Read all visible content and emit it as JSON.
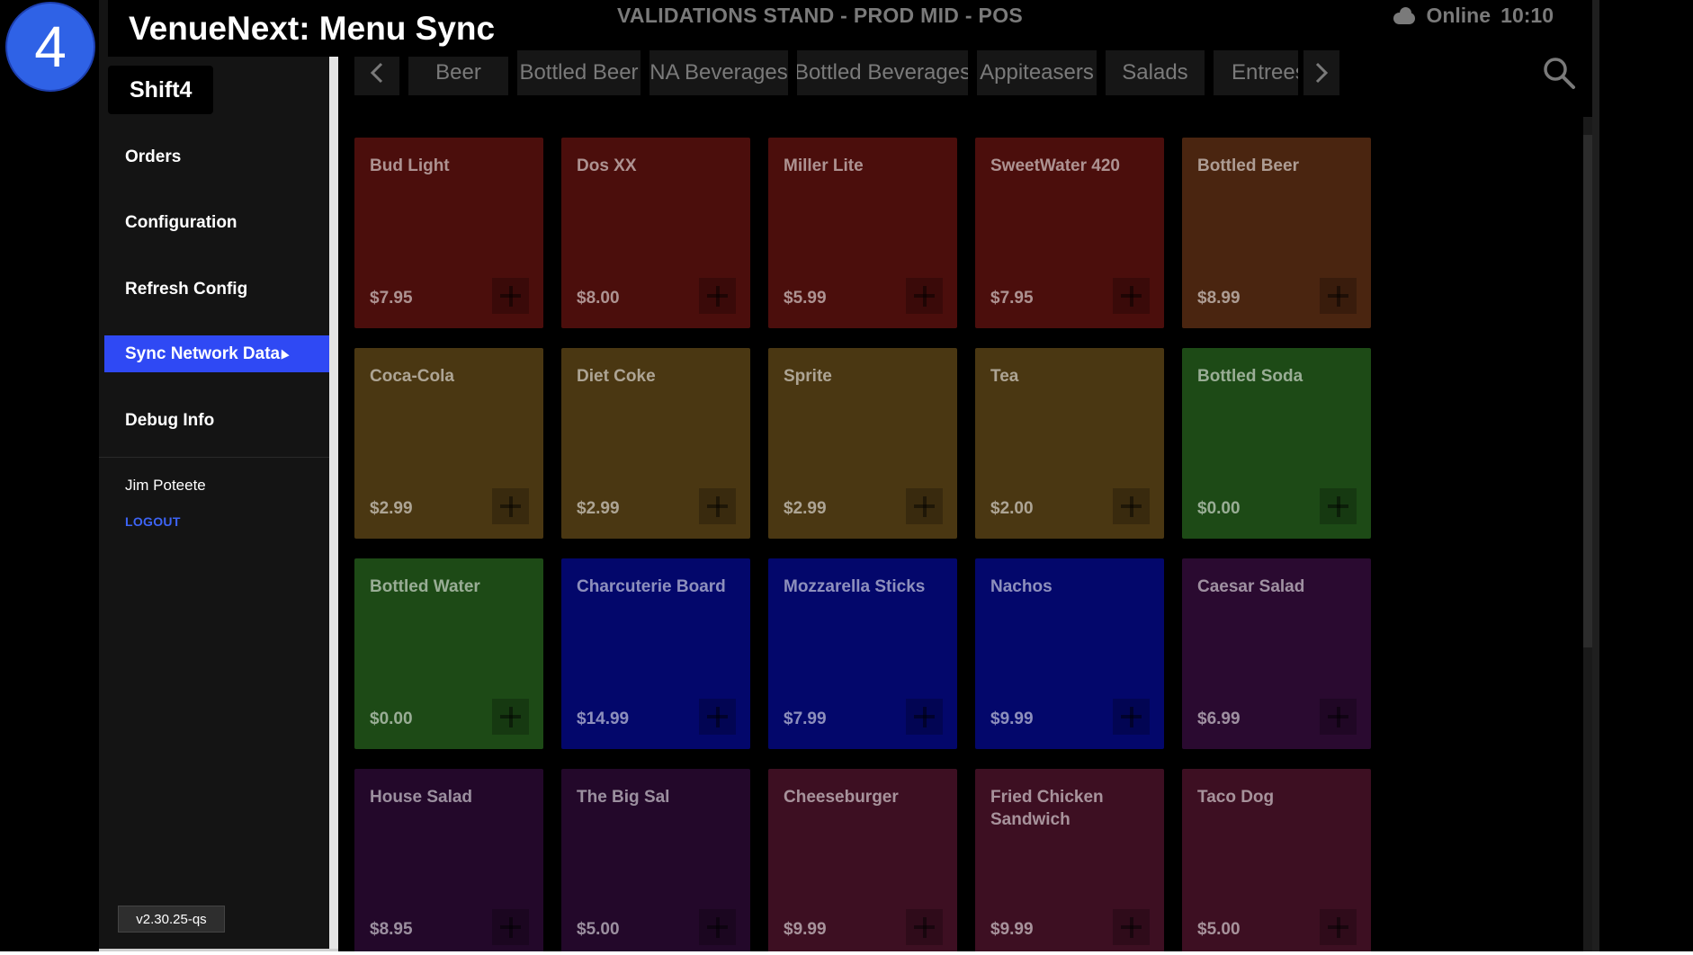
{
  "overlay": {
    "step_number": "4",
    "caption": "VenueNext: Menu Sync",
    "subcaption": "Shift4"
  },
  "sidebar": {
    "items": [
      {
        "label": "Orders",
        "active": false
      },
      {
        "label": "Configuration",
        "active": false
      },
      {
        "label": "Refresh Config",
        "active": false
      },
      {
        "label": "Sync Network Data",
        "active": true
      },
      {
        "label": "Debug Info",
        "active": false
      }
    ],
    "user_name": "Jim Poteete",
    "logout_label": "LOGOUT",
    "version": "v2.30.25-qs"
  },
  "header": {
    "title": "VALIDATIONS STAND - PROD MID - POS",
    "status": "Online",
    "time": "10:10",
    "status_icon": "cloud-check-icon"
  },
  "tabs": [
    "Beer",
    "Bottled Beer",
    "NA Beverages",
    "Bottled Beverages",
    "Appiteasers",
    "Salads",
    "Entrees"
  ],
  "tiles": [
    {
      "name": "Bud Light",
      "price": "$7.95",
      "color": "#4b0e0c"
    },
    {
      "name": "Dos XX",
      "price": "$8.00",
      "color": "#4b0e0c"
    },
    {
      "name": "Miller Lite",
      "price": "$5.99",
      "color": "#4b0e0c"
    },
    {
      "name": "SweetWater 420",
      "price": "$7.95",
      "color": "#4b0e0c"
    },
    {
      "name": "Bottled Beer",
      "price": "$8.99",
      "color": "#4a2510"
    },
    {
      "name": "Coca-Cola",
      "price": "$2.99",
      "color": "#4a3712"
    },
    {
      "name": "Diet Coke",
      "price": "$2.99",
      "color": "#4a3712"
    },
    {
      "name": "Sprite",
      "price": "$2.99",
      "color": "#4a3712"
    },
    {
      "name": "Tea",
      "price": "$2.00",
      "color": "#4a3712"
    },
    {
      "name": "Bottled Soda",
      "price": "$0.00",
      "color": "#1d4a16"
    },
    {
      "name": "Bottled Water",
      "price": "$0.00",
      "color": "#1d4a16"
    },
    {
      "name": "Charcuterie Board",
      "price": "$14.99",
      "color": "#03076b"
    },
    {
      "name": "Mozzarella Sticks",
      "price": "$7.99",
      "color": "#03076b"
    },
    {
      "name": "Nachos",
      "price": "$9.99",
      "color": "#03076b"
    },
    {
      "name": "Caesar Salad",
      "price": "$6.99",
      "color": "#2a0a30"
    },
    {
      "name": "House Salad",
      "price": "$8.95",
      "color": "#23082a"
    },
    {
      "name": "The Big Sal",
      "price": "$5.00",
      "color": "#23082a"
    },
    {
      "name": "Cheeseburger",
      "price": "$9.99",
      "color": "#3d0f22"
    },
    {
      "name": "Fried Chicken Sandwich",
      "price": "$9.99",
      "color": "#3d0f22"
    },
    {
      "name": "Taco Dog",
      "price": "$5.00",
      "color": "#3d0f22"
    }
  ],
  "colors": {
    "accent": "#2f49f4",
    "logout": "#3d64f5"
  }
}
